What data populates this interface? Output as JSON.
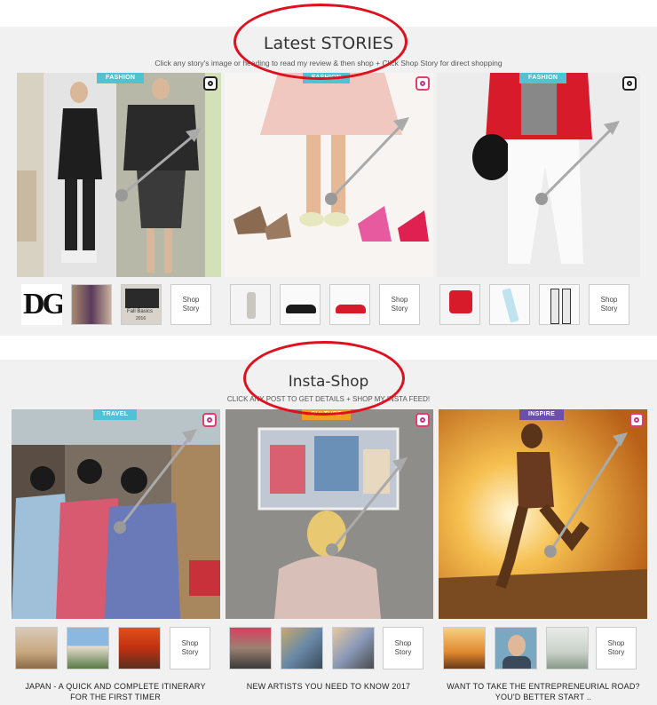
{
  "latest": {
    "title": "Latest STORIES",
    "subtitle": "Click any story's image or heading to read my review & then shop + Click Shop Story for direct shopping",
    "cards": [
      {
        "tag": "FASHION",
        "tag_color": "#4fc3d5"
      },
      {
        "tag": "FASHION",
        "tag_color": "#4fc3d5"
      },
      {
        "tag": "FASHION",
        "tag_color": "#4fc3d5"
      }
    ],
    "thumb_text": {
      "dg": "DG",
      "fall": "Fall Basics",
      "fall_sub": "2016"
    },
    "shop_label_1": "Shop",
    "shop_label_2": "Story"
  },
  "insta": {
    "title": "Insta-Shop",
    "subtitle": "CLICK ANY POST TO GET DETAILS + SHOP MY INSTA FEED!",
    "cards": [
      {
        "tag": "TRAVEL",
        "tag_color": "#4fc3d5",
        "caption_1": "JAPAN - A QUICK AND COMPLETE ITINERARY",
        "caption_2": "FOR THE FIRST TIMER"
      },
      {
        "tag": "CULTURE",
        "tag_color": "#f0a020",
        "caption_1": "NEW ARTISTS YOU NEED TO KNOW 2017",
        "caption_2": ""
      },
      {
        "tag": "INSPIRE",
        "tag_color": "#6c4fa8",
        "caption_1": "WANT TO TAKE THE ENTREPRENEURIAL ROAD?",
        "caption_2": "YOU'D BETTER START .."
      }
    ],
    "shop_label_1": "Shop",
    "shop_label_2": "Story"
  },
  "colors": {
    "annotation_ring": "#e0101e",
    "tag_blue": "#4fc3d5",
    "tag_orange": "#f0a020",
    "tag_purple": "#6c4fa8"
  },
  "icons": [
    "instagram-icon",
    "annotation-arrow"
  ]
}
